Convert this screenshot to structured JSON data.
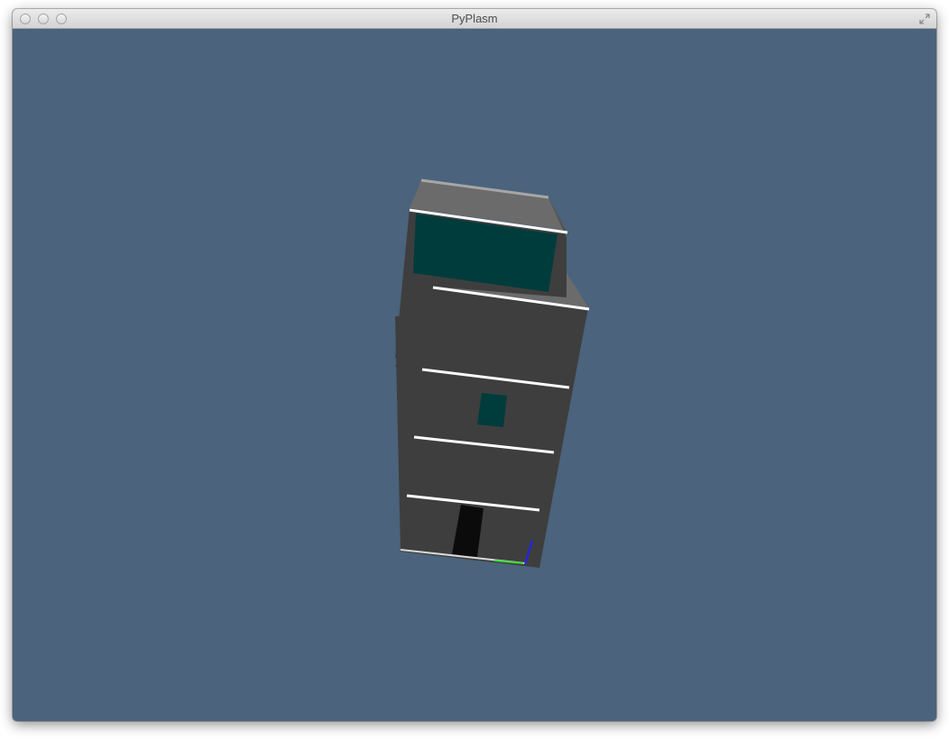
{
  "window": {
    "title": "PyPlasm"
  },
  "viewport": {
    "background_color": "#4b637c"
  },
  "model": {
    "wall_color": "#3e3e3e",
    "top_color": "#6b6b6b",
    "window_color": "#003c3c",
    "door_color": "#0b0b0b",
    "trim_color": "#ffffff"
  },
  "icons": {
    "close": "close-icon",
    "minimize": "minimize-icon",
    "zoom": "zoom-icon",
    "fullscreen": "fullscreen-icon"
  }
}
